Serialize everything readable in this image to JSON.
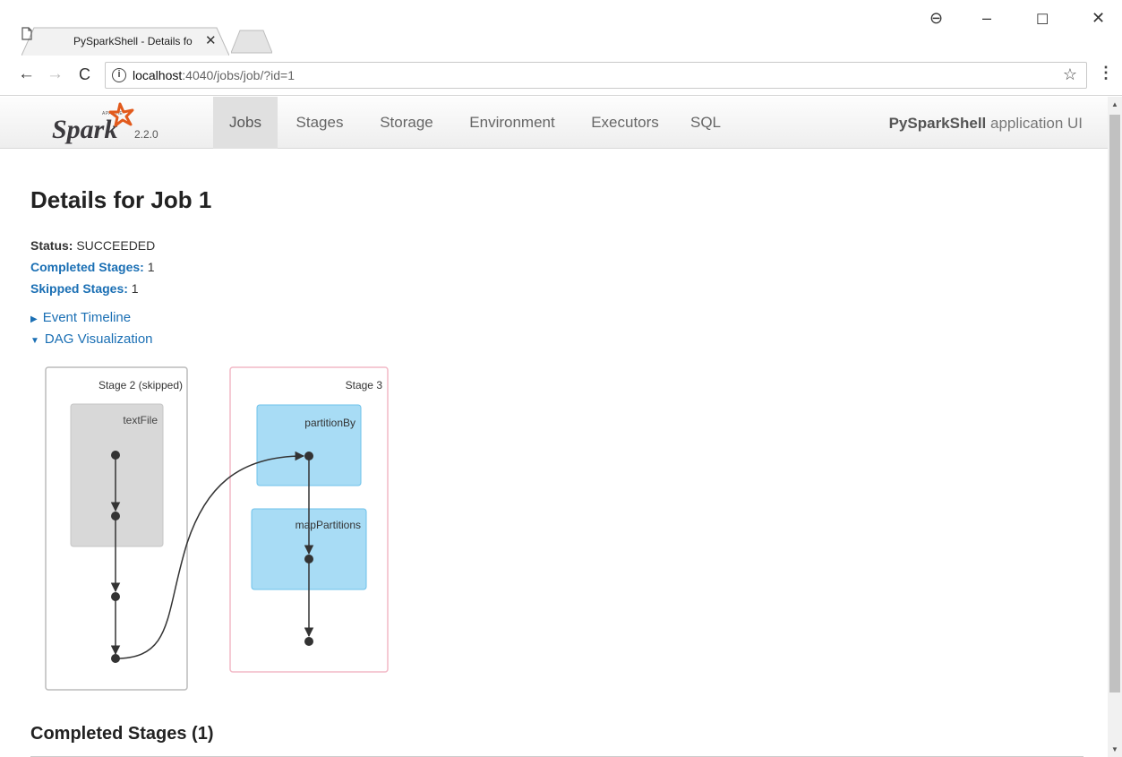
{
  "browser": {
    "tab_title": "PySparkShell - Details fo",
    "url_host": "localhost",
    "url_path": ":4040/jobs/job/?id=1"
  },
  "spark": {
    "version": "2.2.0",
    "nav": [
      "Jobs",
      "Stages",
      "Storage",
      "Environment",
      "Executors",
      "SQL"
    ],
    "active_nav": "Jobs",
    "app_name_bold": "PySparkShell",
    "app_name_rest": " application UI"
  },
  "page": {
    "title": "Details for Job 1",
    "status_label": "Status:",
    "status_value": " SUCCEEDED",
    "completed_label": "Completed Stages:",
    "completed_value": " 1",
    "skipped_label": "Skipped Stages:",
    "skipped_value": " 1",
    "event_timeline": "Event Timeline",
    "dag_visualization": "DAG Visualization",
    "completed_stages_heading": "Completed Stages (1)"
  },
  "dag": {
    "stage_a_label": "Stage 2 (skipped)",
    "stage_a_rdd": "textFile",
    "stage_b_label": "Stage 3",
    "stage_b_rdd1": "partitionBy",
    "stage_b_rdd2": "mapPartitions"
  }
}
